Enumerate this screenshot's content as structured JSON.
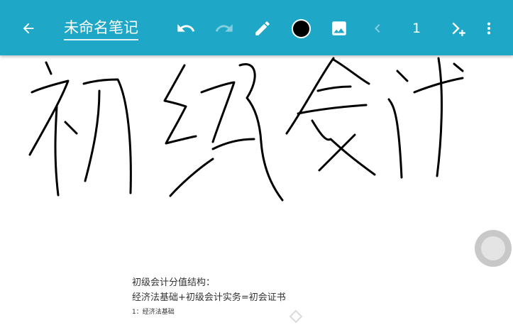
{
  "toolbar": {
    "title": "未命名笔记",
    "page_number": "1",
    "background_color": "#1ea7c6",
    "icons": {
      "back": "arrow-left-icon",
      "undo": "undo-icon",
      "redo": "redo-icon",
      "pen": "pencil-icon",
      "color": "color-swatch",
      "image": "image-icon",
      "prev": "chevron-left-icon",
      "next": "add-page-icon",
      "more": "more-vert-icon"
    },
    "pen_color": "#000000"
  },
  "document": {
    "lines": [
      "初级会计分值结构：",
      "经济法基础+初级会计实务=初会证书",
      "1：经济法基础"
    ]
  }
}
